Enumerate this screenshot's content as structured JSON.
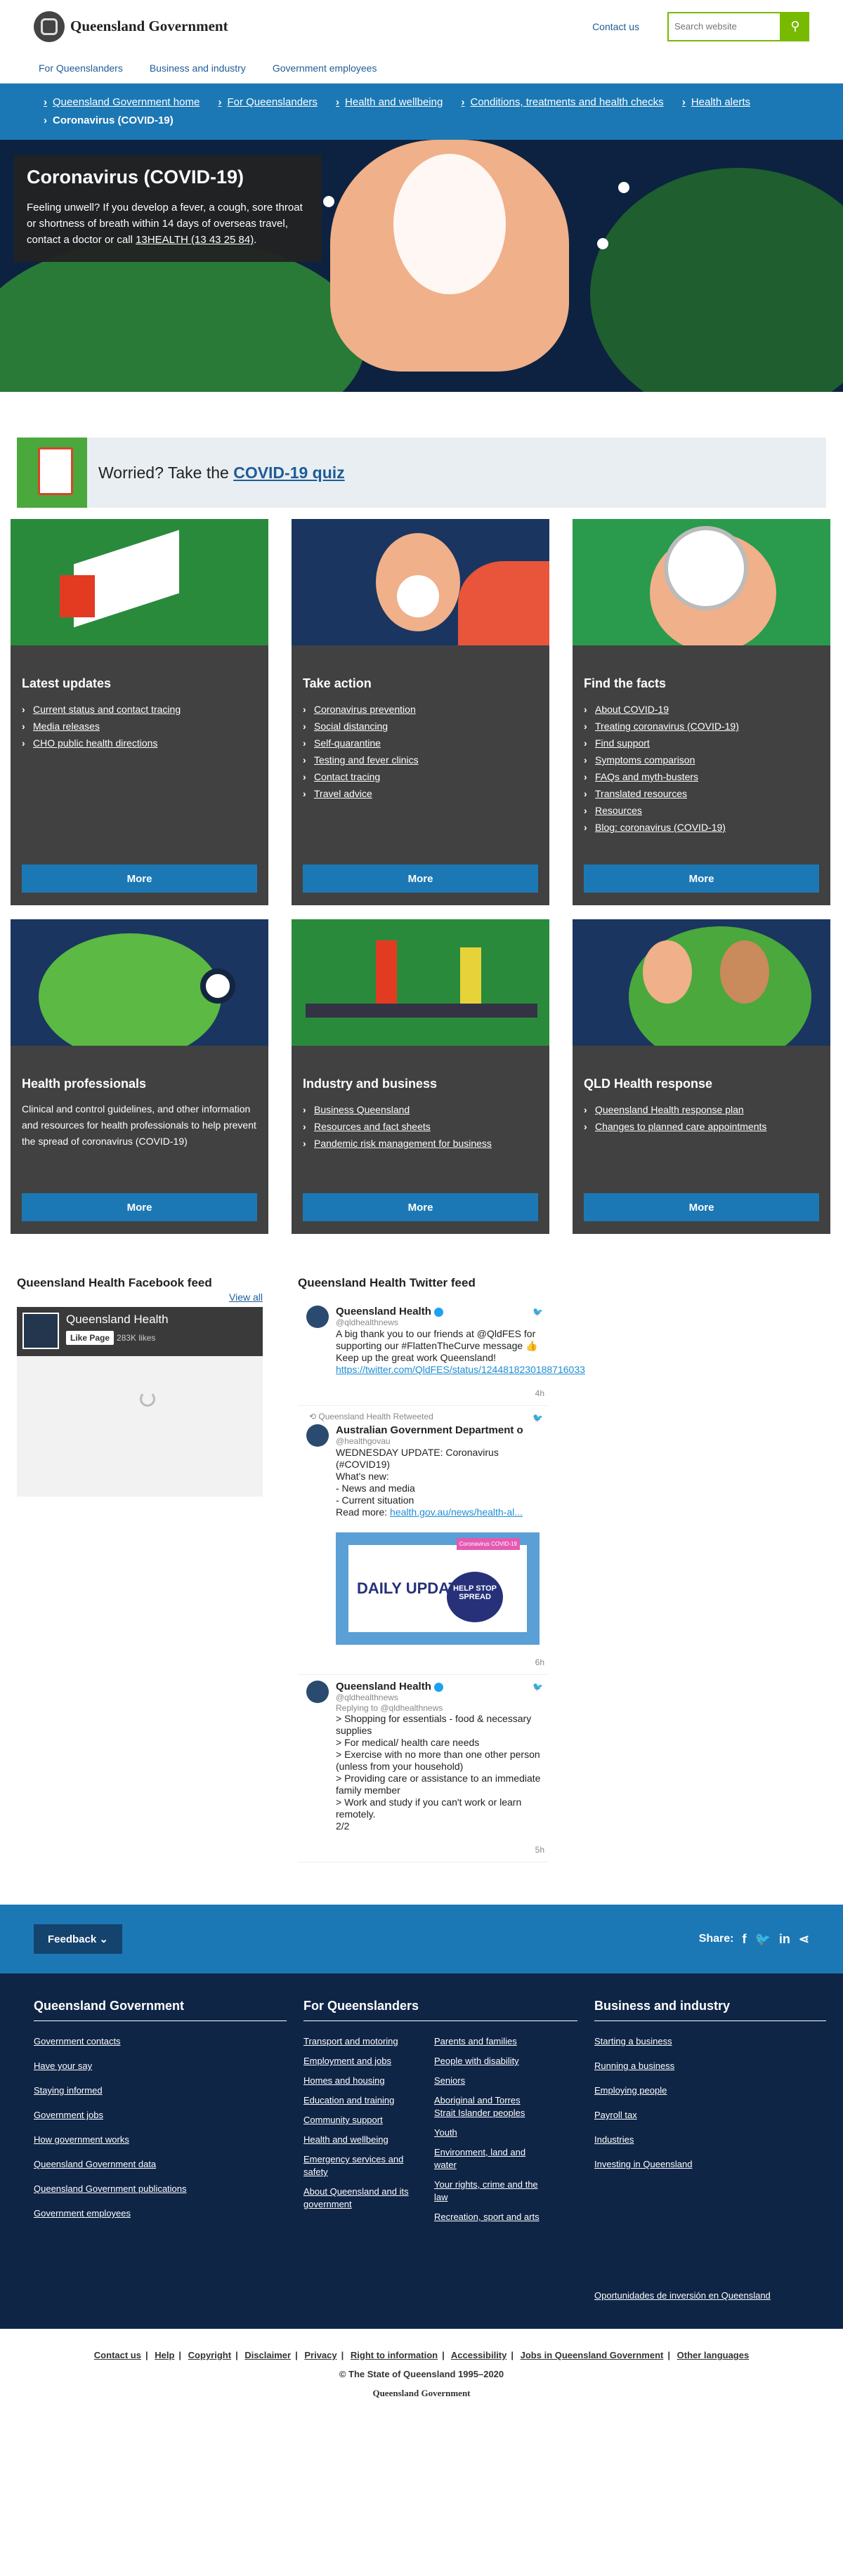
{
  "header": {
    "logo_text": "Queensland Government",
    "contact": "Contact us",
    "search_placeholder": "Search website"
  },
  "nav": [
    "For Queenslanders",
    "Business and industry",
    "Government employees"
  ],
  "breadcrumbs": [
    "Queensland Government home",
    "For Queenslanders",
    "Health and wellbeing",
    "Conditions, treatments and health checks",
    "Health alerts"
  ],
  "current_crumb": "Coronavirus (COVID-19)",
  "hero": {
    "title": "Coronavirus (COVID-19)",
    "text": "Feeling unwell? If you develop a fever, a cough, sore throat or shortness of breath within 14 days of overseas travel, contact a doctor or call ",
    "link": "13HEALTH (13 43 25 84)",
    "tail": "."
  },
  "quiz": {
    "prefix": "Worried? Take the ",
    "link": "COVID-19 quiz"
  },
  "cards": [
    {
      "title": "Latest updates",
      "items": [
        "Current status and contact tracing",
        "Media releases",
        "CHO public health directions"
      ],
      "more": "More",
      "accent": "#2a8a3c"
    },
    {
      "title": "Take action",
      "items": [
        "Coronavirus prevention",
        "Social distancing",
        "Self-quarantine",
        "Testing and fever clinics",
        "Contact tracing",
        "Travel advice"
      ],
      "more": "More",
      "accent": "#1a3560"
    },
    {
      "title": "Find the facts",
      "items": [
        "About COVID-19",
        "Treating coronavirus (COVID-19)",
        "Find support",
        "Symptoms comparison",
        "FAQs and myth-busters",
        "Translated resources",
        "Resources",
        "Blog: coronavirus (COVID-19)"
      ],
      "more": "More",
      "accent": "#2a9a4c"
    },
    {
      "title": "Health professionals",
      "text": "Clinical and control guidelines, and other information and resources for health professionals to help prevent the spread of coronavirus (COVID-19)",
      "more": "More",
      "accent": "#1a3560"
    },
    {
      "title": "Industry and business",
      "items": [
        "Business Queensland",
        "Resources and fact sheets",
        "Pandemic risk management for business"
      ],
      "more": "More",
      "accent": "#2a8a3c"
    },
    {
      "title": "QLD Health response",
      "items": [
        "Queensland Health response plan",
        "Changes to planned care appointments"
      ],
      "more": "More",
      "accent": "#1a3560"
    }
  ],
  "facebook": {
    "title": "Queensland Health Facebook feed",
    "view_all": "View all",
    "page_name": "Queensland Health",
    "like": "Like Page",
    "likes": "283K likes"
  },
  "twitter": {
    "title": "Queensland Health Twitter feed",
    "tweets": [
      {
        "name": "Queensland Health",
        "handle": "@qldhealthnews",
        "text": "A big thank you to our friends at @QldFES for supporting our #FlattenTheCurve message 👍\nKeep up the great work Queensland!",
        "link": "https://twitter.com/QldFES/status/1244818230188716033",
        "time": "4h"
      },
      {
        "retweet": "Queensland Health Retweeted",
        "name": "Australian Government Department o",
        "handle": "@healthgovau",
        "text": "WEDNESDAY UPDATE: Coronavirus (#COVID19)\nWhat's new:\n- News and media\n- Current situation\nRead more: ",
        "link": "health.gov.au/news/health-al...",
        "time": "6h",
        "img_title": "DAILY UPDATE",
        "img_badge": "Coronavirus COVID-19",
        "img_stop": "HELP STOP SPREAD"
      },
      {
        "name": "Queensland Health",
        "handle": "@qldhealthnews",
        "reply": "Replying to @qldhealthnews",
        "text": "> Shopping for essentials - food & necessary supplies\n> For medical/ health care needs\n> Exercise with no more than one other person (unless from your household)\n> Providing care or assistance to an immediate family member\n> Work and study if you can't work or learn remotely.\n2/2",
        "time": "5h"
      }
    ]
  },
  "feedback": "Feedback",
  "share": "Share:",
  "footer": {
    "col1": {
      "title": "Queensland Government",
      "items": [
        "Government contacts",
        "Have your say",
        "Staying informed",
        "Government jobs",
        "How government works",
        "Queensland Government data",
        "Queensland Government publications",
        "Government employees"
      ]
    },
    "col2": {
      "title": "For Queenslanders",
      "left": [
        "Transport and motoring",
        "Employment and jobs",
        "Homes and housing",
        "Education and training",
        "Community support",
        "Health and wellbeing",
        "Emergency services and safety",
        "About Queensland and its government"
      ],
      "right": [
        "Parents and families",
        "People with disability",
        "Seniors",
        "Aboriginal and Torres Strait Islander peoples",
        "Youth",
        "Environment, land and water",
        "Your rights, crime and the law",
        "Recreation, sport and arts"
      ]
    },
    "col3": {
      "title": "Business and industry",
      "items": [
        "Starting a business",
        "Running a business",
        "Employing people",
        "Payroll tax",
        "Industries",
        "Investing in Queensland"
      ],
      "extra": "Oportunidades de inversión en Queensland"
    }
  },
  "bottom": {
    "links": [
      "Contact us",
      "Help",
      "Copyright",
      "Disclaimer",
      "Privacy",
      "Right to information",
      "Accessibility",
      "Jobs in Queensland Government",
      "Other languages"
    ],
    "copyright": "© The State of Queensland 1995–2020",
    "org": "Queensland Government"
  }
}
